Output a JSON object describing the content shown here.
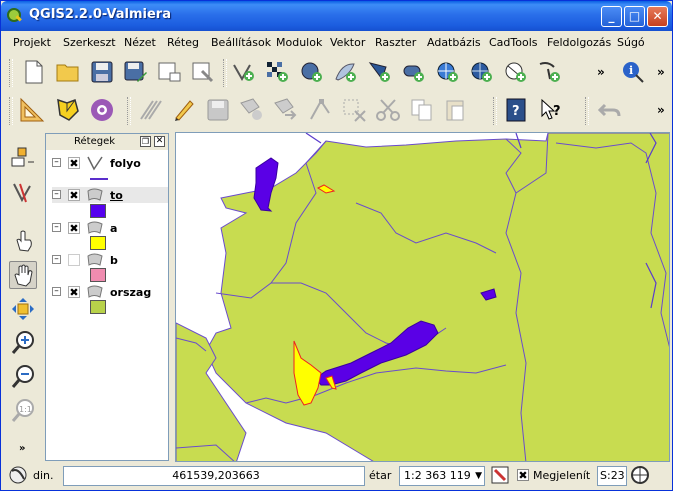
{
  "window": {
    "title": "QGIS2.2.0-Valmiera"
  },
  "menu": [
    "Projekt",
    "Szerkeszt",
    "Nézet",
    "Réteg",
    "Beállítások",
    "Modulok",
    "Vektor",
    "Raszter",
    "Adatbázis",
    "CadTools",
    "Feldolgozás",
    "Súgó"
  ],
  "layers_panel": {
    "title": "Rétegek"
  },
  "layers": [
    {
      "name": "folyo",
      "checked": "✖",
      "color": "#5a2ecc",
      "kind": "line"
    },
    {
      "name": "to",
      "checked": "✖",
      "color": "#5500ee",
      "kind": "polygon"
    },
    {
      "name": "a",
      "checked": "✖",
      "color": "#ffff00",
      "kind": "polygon"
    },
    {
      "name": "b",
      "checked": "",
      "color": "#f08cb0",
      "kind": "polygon"
    },
    {
      "name": "orszag",
      "checked": "✖",
      "color": "#b8d24a",
      "kind": "polygon"
    }
  ],
  "status": {
    "coord_label": "din.",
    "coordinates": "461539,203663",
    "scale_label": "étar",
    "scale": "1:2 363 119",
    "render_label": "Megjelenít",
    "render_checked": "✖",
    "epsg": "S:23"
  },
  "colors": {
    "land": "#c8dc50",
    "water": "#5a00e6",
    "river": "#5a3ccc",
    "yellow": "#ffff00"
  }
}
